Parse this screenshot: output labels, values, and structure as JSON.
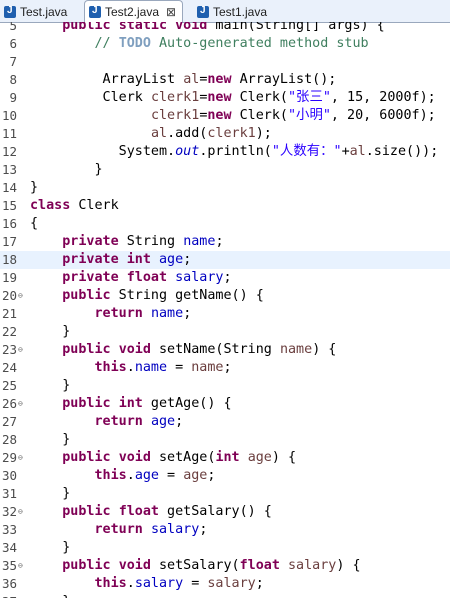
{
  "tabs": [
    {
      "label": "Test.java",
      "active": false
    },
    {
      "label": "Test2.java",
      "active": true,
      "close": "⊠"
    },
    {
      "label": "Test1.java",
      "active": false
    }
  ],
  "editor": {
    "highlighted_line": "18",
    "lines": [
      {
        "num": "5",
        "fold": "",
        "parts": [
          [
            "    ",
            ""
          ],
          [
            "public",
            "kw"
          ],
          [
            " ",
            ""
          ],
          [
            "static",
            "kw"
          ],
          [
            " ",
            ""
          ],
          [
            "void",
            "kw"
          ],
          [
            " main(String[] args) {",
            ""
          ]
        ]
      },
      {
        "num": "6",
        "fold": "",
        "parts": [
          [
            "        ",
            ""
          ],
          [
            "// ",
            "cm"
          ],
          [
            "TODO",
            "todo"
          ],
          [
            " Auto-generated method stub",
            "cm"
          ]
        ]
      },
      {
        "num": "7",
        "fold": "",
        "parts": []
      },
      {
        "num": "8",
        "fold": "",
        "parts": [
          [
            "         ArrayList ",
            ""
          ],
          [
            "al",
            "var"
          ],
          [
            "=",
            ""
          ],
          [
            "new",
            "kw"
          ],
          [
            " ArrayList();",
            ""
          ]
        ]
      },
      {
        "num": "9",
        "fold": "",
        "parts": [
          [
            "         Clerk ",
            ""
          ],
          [
            "clerk1",
            "var"
          ],
          [
            "=",
            ""
          ],
          [
            "new",
            "kw"
          ],
          [
            " Clerk(",
            ""
          ],
          [
            "\"张三\"",
            "str"
          ],
          [
            ", 15, 2000f);",
            ""
          ]
        ]
      },
      {
        "num": "10",
        "fold": "",
        "parts": [
          [
            "               ",
            ""
          ],
          [
            "clerk1",
            "var"
          ],
          [
            "=",
            ""
          ],
          [
            "new",
            "kw"
          ],
          [
            " Clerk(",
            ""
          ],
          [
            "\"小明\"",
            "str"
          ],
          [
            ", 20, 6000f);",
            ""
          ]
        ]
      },
      {
        "num": "11",
        "fold": "",
        "parts": [
          [
            "               ",
            ""
          ],
          [
            "al",
            "var"
          ],
          [
            ".add(",
            ""
          ],
          [
            "clerk1",
            "var"
          ],
          [
            ");",
            ""
          ]
        ]
      },
      {
        "num": "12",
        "fold": "",
        "parts": [
          [
            "           System.",
            ""
          ],
          [
            "out",
            "sf"
          ],
          [
            ".println(",
            ""
          ],
          [
            "\"人数有：\"",
            "str"
          ],
          [
            "+",
            ""
          ],
          [
            "al",
            "var"
          ],
          [
            ".size());",
            ""
          ]
        ]
      },
      {
        "num": "13",
        "fold": "",
        "parts": [
          [
            "        }",
            ""
          ]
        ]
      },
      {
        "num": "14",
        "fold": "",
        "parts": [
          [
            "}",
            ""
          ]
        ]
      },
      {
        "num": "15",
        "fold": "",
        "parts": [
          [
            "class",
            "kw"
          ],
          [
            " Clerk",
            ""
          ]
        ]
      },
      {
        "num": "16",
        "fold": "",
        "parts": [
          [
            "{",
            ""
          ]
        ]
      },
      {
        "num": "17",
        "fold": "",
        "parts": [
          [
            "    ",
            ""
          ],
          [
            "private",
            "kw"
          ],
          [
            " String ",
            ""
          ],
          [
            "name",
            "fld"
          ],
          [
            ";",
            ""
          ]
        ]
      },
      {
        "num": "18",
        "fold": "",
        "parts": [
          [
            "    ",
            ""
          ],
          [
            "private",
            "kw"
          ],
          [
            " ",
            ""
          ],
          [
            "int",
            "kw"
          ],
          [
            " ",
            ""
          ],
          [
            "age",
            "fld"
          ],
          [
            ";",
            ""
          ]
        ]
      },
      {
        "num": "19",
        "fold": "",
        "parts": [
          [
            "    ",
            ""
          ],
          [
            "private",
            "kw"
          ],
          [
            " ",
            ""
          ],
          [
            "float",
            "kw"
          ],
          [
            " ",
            ""
          ],
          [
            "salary",
            "fld"
          ],
          [
            ";",
            ""
          ]
        ]
      },
      {
        "num": "20",
        "fold": "⊖",
        "parts": [
          [
            "    ",
            ""
          ],
          [
            "public",
            "kw"
          ],
          [
            " String getName() {",
            ""
          ]
        ]
      },
      {
        "num": "21",
        "fold": "",
        "parts": [
          [
            "        ",
            ""
          ],
          [
            "return",
            "kw"
          ],
          [
            " ",
            ""
          ],
          [
            "name",
            "fld"
          ],
          [
            ";",
            ""
          ]
        ]
      },
      {
        "num": "22",
        "fold": "",
        "parts": [
          [
            "    }",
            ""
          ]
        ]
      },
      {
        "num": "23",
        "fold": "⊖",
        "parts": [
          [
            "    ",
            ""
          ],
          [
            "public",
            "kw"
          ],
          [
            " ",
            ""
          ],
          [
            "void",
            "kw"
          ],
          [
            " setName(String ",
            ""
          ],
          [
            "name",
            "var"
          ],
          [
            ") {",
            ""
          ]
        ]
      },
      {
        "num": "24",
        "fold": "",
        "parts": [
          [
            "        ",
            ""
          ],
          [
            "this",
            "kw"
          ],
          [
            ".",
            ""
          ],
          [
            "name",
            "fld"
          ],
          [
            " = ",
            ""
          ],
          [
            "name",
            "var"
          ],
          [
            ";",
            ""
          ]
        ]
      },
      {
        "num": "25",
        "fold": "",
        "parts": [
          [
            "    }",
            ""
          ]
        ]
      },
      {
        "num": "26",
        "fold": "⊖",
        "parts": [
          [
            "    ",
            ""
          ],
          [
            "public",
            "kw"
          ],
          [
            " ",
            ""
          ],
          [
            "int",
            "kw"
          ],
          [
            " getAge() {",
            ""
          ]
        ]
      },
      {
        "num": "27",
        "fold": "",
        "parts": [
          [
            "        ",
            ""
          ],
          [
            "return",
            "kw"
          ],
          [
            " ",
            ""
          ],
          [
            "age",
            "fld"
          ],
          [
            ";",
            ""
          ]
        ]
      },
      {
        "num": "28",
        "fold": "",
        "parts": [
          [
            "    }",
            ""
          ]
        ]
      },
      {
        "num": "29",
        "fold": "⊖",
        "parts": [
          [
            "    ",
            ""
          ],
          [
            "public",
            "kw"
          ],
          [
            " ",
            ""
          ],
          [
            "void",
            "kw"
          ],
          [
            " setAge(",
            ""
          ],
          [
            "int",
            "kw"
          ],
          [
            " ",
            ""
          ],
          [
            "age",
            "var"
          ],
          [
            ") {",
            ""
          ]
        ]
      },
      {
        "num": "30",
        "fold": "",
        "parts": [
          [
            "        ",
            ""
          ],
          [
            "this",
            "kw"
          ],
          [
            ".",
            ""
          ],
          [
            "age",
            "fld"
          ],
          [
            " = ",
            ""
          ],
          [
            "age",
            "var"
          ],
          [
            ";",
            ""
          ]
        ]
      },
      {
        "num": "31",
        "fold": "",
        "parts": [
          [
            "    }",
            ""
          ]
        ]
      },
      {
        "num": "32",
        "fold": "⊖",
        "parts": [
          [
            "    ",
            ""
          ],
          [
            "public",
            "kw"
          ],
          [
            " ",
            ""
          ],
          [
            "float",
            "kw"
          ],
          [
            " getSalary() {",
            ""
          ]
        ]
      },
      {
        "num": "33",
        "fold": "",
        "parts": [
          [
            "        ",
            ""
          ],
          [
            "return",
            "kw"
          ],
          [
            " ",
            ""
          ],
          [
            "salary",
            "fld"
          ],
          [
            ";",
            ""
          ]
        ]
      },
      {
        "num": "34",
        "fold": "",
        "parts": [
          [
            "    }",
            ""
          ]
        ]
      },
      {
        "num": "35",
        "fold": "⊖",
        "parts": [
          [
            "    ",
            ""
          ],
          [
            "public",
            "kw"
          ],
          [
            " ",
            ""
          ],
          [
            "void",
            "kw"
          ],
          [
            " setSalary(",
            ""
          ],
          [
            "float",
            "kw"
          ],
          [
            " ",
            ""
          ],
          [
            "salary",
            "var"
          ],
          [
            ") {",
            ""
          ]
        ]
      },
      {
        "num": "36",
        "fold": "",
        "parts": [
          [
            "        ",
            ""
          ],
          [
            "this",
            "kw"
          ],
          [
            ".",
            ""
          ],
          [
            "salary",
            "fld"
          ],
          [
            " = ",
            ""
          ],
          [
            "salary",
            "var"
          ],
          [
            ";",
            ""
          ]
        ]
      },
      {
        "num": "37",
        "fold": "",
        "parts": [
          [
            "    }",
            ""
          ]
        ]
      }
    ]
  }
}
